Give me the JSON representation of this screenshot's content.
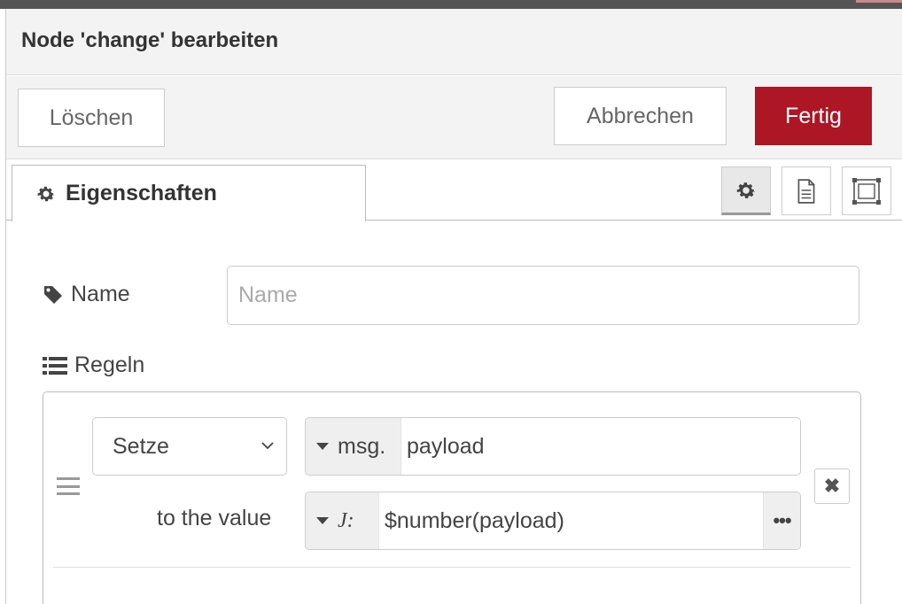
{
  "dialog": {
    "title": "Node 'change' bearbeiten"
  },
  "toolbar": {
    "delete_label": "Löschen",
    "cancel_label": "Abbrechen",
    "done_label": "Fertig",
    "done_color": "#ad1625"
  },
  "tabs": {
    "properties_label": "Eigenschaften",
    "icons": [
      "gear-icon",
      "document-icon",
      "frame-icon"
    ]
  },
  "form": {
    "name_label": "Name",
    "name_placeholder": "Name",
    "name_value": "",
    "rules_label": "Regeln"
  },
  "rule": {
    "action": "Setze",
    "target_type": "msg.",
    "target_value": "payload",
    "to_label": "to the value",
    "value_type": "J:",
    "value_expression": "$number(payload)",
    "expand_label": "•••",
    "remove_label": "✖"
  }
}
